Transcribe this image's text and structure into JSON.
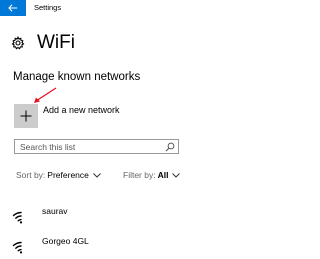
{
  "window": {
    "app_title": "Settings",
    "accent_color": "#0078d7"
  },
  "header": {
    "icon": "gear-icon",
    "title": "WiFi"
  },
  "section": {
    "heading": "Manage known networks"
  },
  "add_network": {
    "icon": "plus-icon",
    "label": "Add a new network"
  },
  "annotation": {
    "icon": "red-arrow-icon",
    "color": "#e81123"
  },
  "search": {
    "placeholder": "Search this list",
    "value": "",
    "icon": "search-icon"
  },
  "sort": {
    "label": "Sort by:",
    "value": "Preference"
  },
  "filter": {
    "label": "Filter by:",
    "value": "All"
  },
  "networks": [
    {
      "name": "saurav",
      "icon": "wifi-signal-icon"
    },
    {
      "name": "Gorgeo 4GL",
      "icon": "wifi-signal-icon"
    }
  ]
}
